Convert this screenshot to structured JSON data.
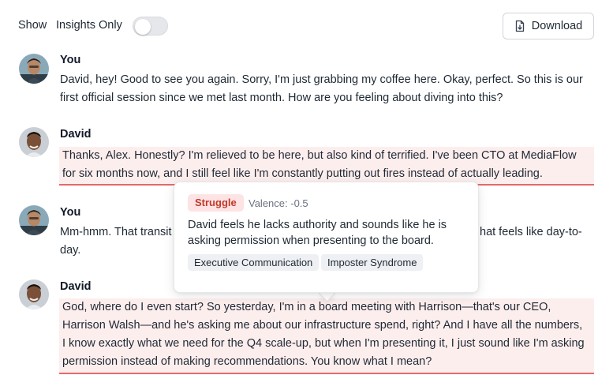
{
  "toolbar": {
    "show_label": "Show",
    "insights_label": "Insights Only",
    "insights_only_enabled": false,
    "download_label": "Download",
    "download_icon": "file-download-icon"
  },
  "messages": [
    {
      "speaker": "You",
      "text": "David, hey! Good to see you again. Sorry, I'm just grabbing my coffee here. Okay, perfect. So this is our first official session since we met last month. How are you feeling about diving into this?",
      "highlighted": false
    },
    {
      "speaker": "David",
      "text": "Thanks, Alex. Honestly? I'm relieved to be here, but also kind of terrified. I've been CTO at MediaFlow for six months now, and I still feel like I'm constantly putting out fires instead of actually leading.",
      "highlighted": true
    },
    {
      "speaker": "You",
      "text": "Mm-hmm. That transit",
      "text_tail": "hat feels like day-to-",
      "text_line2": "day.",
      "highlighted": false
    },
    {
      "speaker": "David",
      "text": "God, where do I even start? So yesterday, I'm in a board meeting with Harrison—that's our CEO, Harrison Walsh—and he's asking me about our infrastructure spend, right? And I have all the numbers, I know exactly what we need for the Q4 scale-up, but when I'm presenting it, I just sound like I'm asking permission instead of making recommendations. You know what I mean?",
      "highlighted": true
    }
  ],
  "tooltip": {
    "tag": "Struggle",
    "valence": "Valence: -0.5",
    "description": "David feels he lacks authority and sounds like he is asking permission when presenting to the board.",
    "chips": [
      "Executive Communication",
      "Imposter Syndrome"
    ]
  },
  "colors": {
    "highlight_bg": "#fdeeee",
    "highlight_underline": "#e46a6a",
    "struggle_tag_bg": "#fde3e3",
    "struggle_tag_text": "#c0392b"
  }
}
